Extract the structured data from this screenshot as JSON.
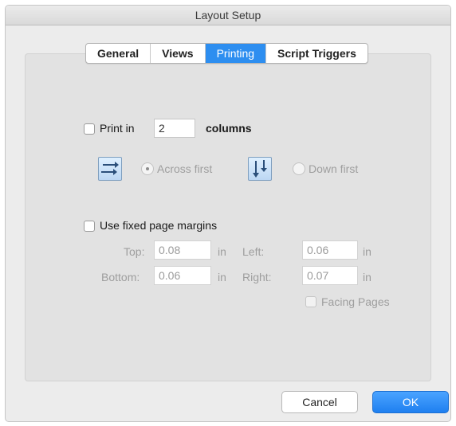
{
  "window": {
    "title": "Layout Setup"
  },
  "tabs": [
    {
      "label": "General",
      "active": false
    },
    {
      "label": "Views",
      "active": false
    },
    {
      "label": "Printing",
      "active": true
    },
    {
      "label": "Script Triggers",
      "active": false
    }
  ],
  "print_columns": {
    "checkbox_label": "Print in",
    "checked": false,
    "columns_value": "2",
    "suffix_label": "columns",
    "across_first_label": "Across first",
    "down_first_label": "Down first",
    "selected_order": "Across first",
    "across_icon": "across-first-icon",
    "down_icon": "down-first-icon"
  },
  "margins": {
    "checkbox_label": "Use fixed page margins",
    "checked": false,
    "top_label": "Top:",
    "top_value": "0.08",
    "bottom_label": "Bottom:",
    "bottom_value": "0.06",
    "left_label": "Left:",
    "left_value": "0.06",
    "right_label": "Right:",
    "right_value": "0.07",
    "unit": "in",
    "facing_pages_label": "Facing Pages",
    "facing_pages_checked": false
  },
  "buttons": {
    "cancel_label": "Cancel",
    "ok_label": "OK"
  },
  "colors": {
    "accent": "#2d8ef0",
    "ok_button": "#1f80f0",
    "panel": "#e2e2e2",
    "window": "#ececec"
  }
}
